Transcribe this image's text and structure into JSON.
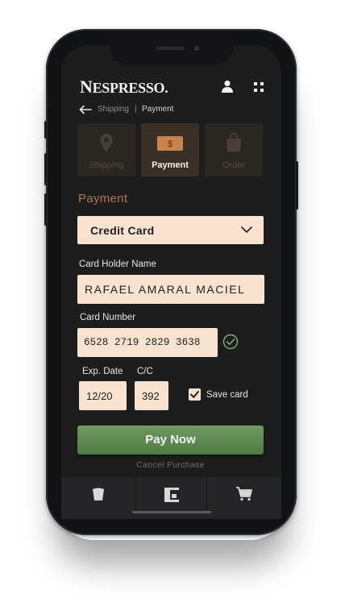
{
  "brand": {
    "logo_text": "NESPRESSO.",
    "logo_first": "N",
    "logo_rest": "ESPRESSO."
  },
  "breadcrumb": {
    "prev": "Shipping",
    "separator": "|",
    "current": "Payment"
  },
  "steps": [
    {
      "label": "Shipping",
      "icon": "location-pin-icon",
      "active": false
    },
    {
      "label": "Payment",
      "icon": "money-icon",
      "active": true
    },
    {
      "label": "Order",
      "icon": "shopping-bag-icon",
      "active": false
    }
  ],
  "payment": {
    "section_title": "Payment",
    "method": "Credit Card",
    "holder_label": "Card Holder Name",
    "holder_value": "RAFAEL AMARAL MACIEL",
    "number_label": "Card Number",
    "number_value": "6528 2719 2829 3638",
    "exp_label": "Exp. Date",
    "exp_value": "12/20",
    "cvc_label": "C/C",
    "cvc_value": "392",
    "save_label": "Save card",
    "save_checked": true
  },
  "actions": {
    "pay": "Pay Now",
    "cancel": "Cancel Purchase"
  },
  "tabbar": [
    {
      "icon": "coffee-cup-icon"
    },
    {
      "icon": "coffee-machine-icon"
    },
    {
      "icon": "cart-icon"
    }
  ],
  "colors": {
    "accent": "#b0784a",
    "field_bg": "#f9e3d0",
    "pay_green": "#5f8a55",
    "screen_bg": "#1d1d1e"
  }
}
